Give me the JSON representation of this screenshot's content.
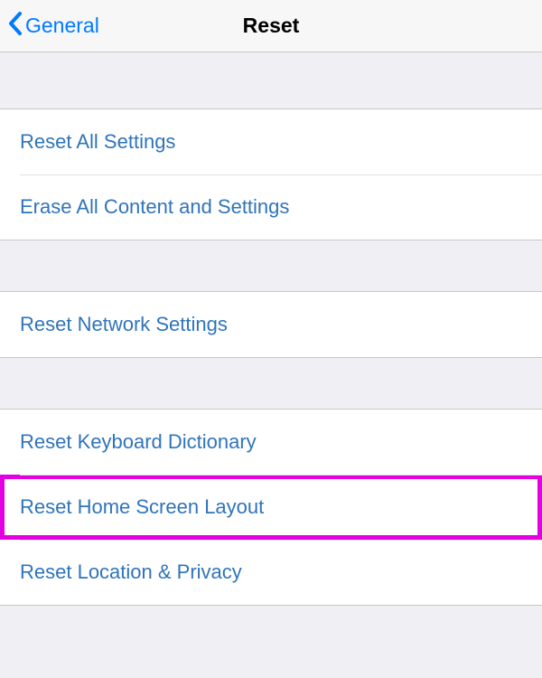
{
  "navbar": {
    "back_label": "General",
    "title": "Reset"
  },
  "sections": [
    {
      "rows": [
        {
          "label": "Reset All Settings"
        },
        {
          "label": "Erase All Content and Settings"
        }
      ]
    },
    {
      "rows": [
        {
          "label": "Reset Network Settings"
        }
      ]
    },
    {
      "rows": [
        {
          "label": "Reset Keyboard Dictionary"
        },
        {
          "label": "Reset Home Screen Layout",
          "highlighted": true
        },
        {
          "label": "Reset Location & Privacy"
        }
      ]
    }
  ]
}
